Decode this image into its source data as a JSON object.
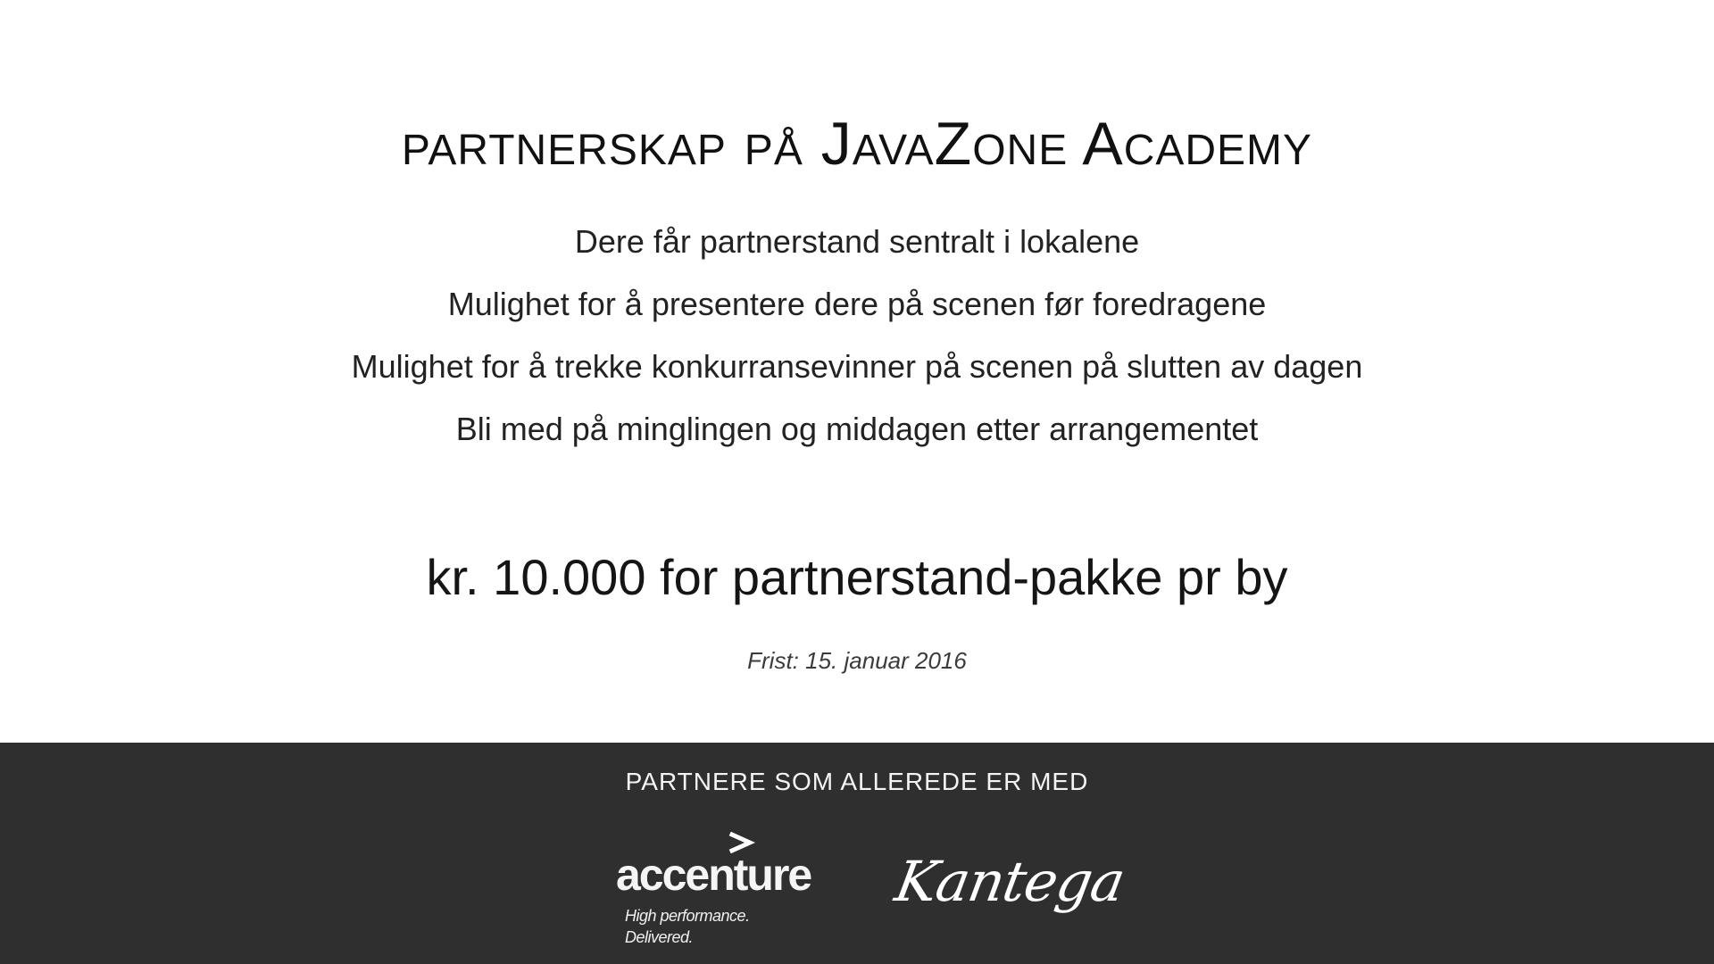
{
  "title": "partnerskap på JavaZone Academy",
  "features": [
    "Dere får partnerstand sentralt i lokalene",
    "Mulighet for å presentere dere på scenen før foredragene",
    "Mulighet for å trekke konkurransevinner på scenen på slutten av dagen",
    "Bli med på minglingen og middagen etter arrangementet"
  ],
  "price": "kr. 10.000 for partnerstand-pakke pr by",
  "deadline": "Frist: 15. januar 2016",
  "footer": {
    "heading": "PARTNERE SOM ALLEREDE ER MED",
    "partners": [
      {
        "name": "accenture",
        "tagline": "High performance. Delivered."
      },
      {
        "name": "Kantega"
      }
    ]
  },
  "colors": {
    "background": "#ffffff",
    "footer_background": "#2f2f2f",
    "text": "#1e1e1e",
    "footer_text": "#f4f4f4"
  }
}
